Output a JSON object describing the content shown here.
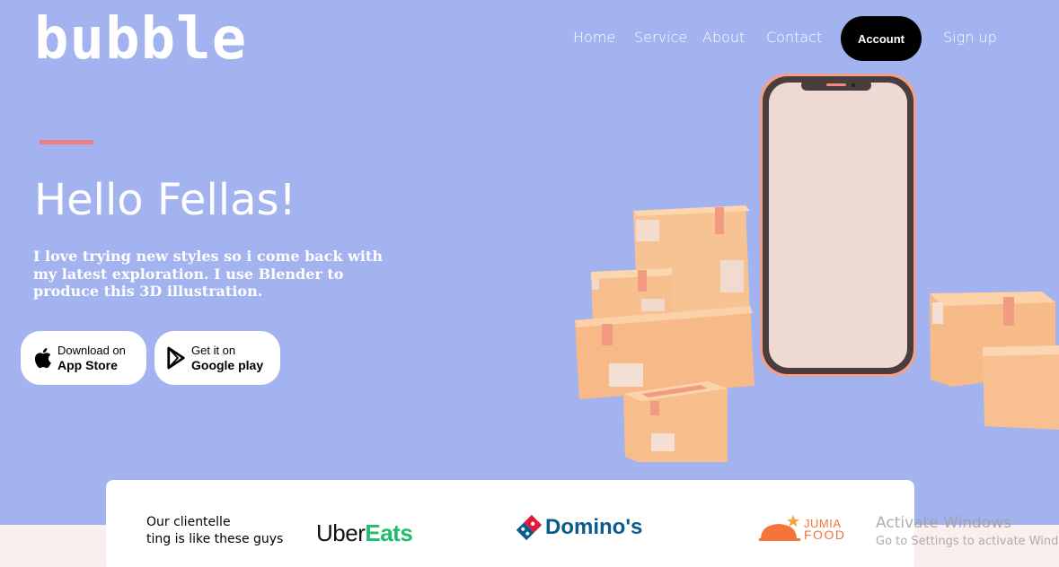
{
  "brand": {
    "logo": "bubble"
  },
  "nav": {
    "items": [
      "Home",
      "Service",
      "About",
      "Contact"
    ],
    "account": "Account",
    "signup": "Sign up"
  },
  "hero": {
    "title": "Hello Fellas!",
    "description": "I love trying new styles so i come back with my latest exploration. I use Blender to produce this 3D illustration."
  },
  "stores": [
    {
      "small": "Download on",
      "big": "App Store",
      "icon": "apple-icon"
    },
    {
      "small": "Get it on",
      "big": "Google play",
      "icon": "play-store-icon"
    }
  ],
  "clients": {
    "line1": "Our clientelle",
    "line2": "ting is like these guys",
    "logos": [
      {
        "part1": "Uber",
        "part2": "Eats"
      },
      {
        "name": "Domino's"
      },
      {
        "top": "JUMIA",
        "bottom": "FOOD"
      }
    ]
  },
  "watermark": {
    "line1": "Activate Windows",
    "line2": "Go to Settings to activate Windows."
  },
  "colors": {
    "background": "#a3b3ef",
    "accent": "#f07e86",
    "account_button": "#000000",
    "uber_green": "#1fbd6b",
    "dominos_blue": "#0b5a8c",
    "jumia_orange": "#f4743a",
    "box": "#f5b57e"
  }
}
